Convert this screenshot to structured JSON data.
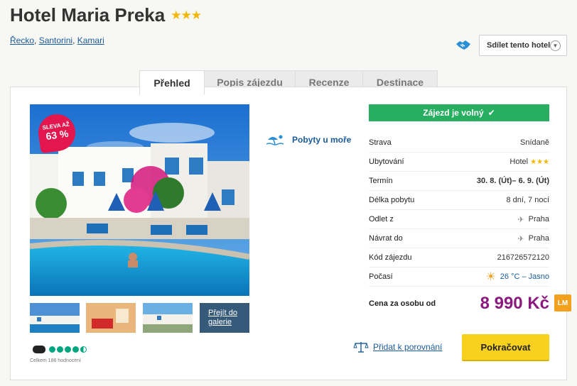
{
  "hotel": {
    "name": "Hotel Maria Preka",
    "stars": "★★★"
  },
  "breadcrumb": [
    "Řecko",
    "Santorini",
    "Kamari"
  ],
  "share": {
    "label": "Sdílet tento hotel"
  },
  "tabs": [
    "Přehled",
    "Popis zájezdu",
    "Recenze",
    "Destinace"
  ],
  "badge": {
    "line1": "SLEVA AŽ",
    "line2": "63 %"
  },
  "gallery": {
    "label": "Přejít do galerie"
  },
  "tripadvisor": {
    "rating": 4.5,
    "count_text": "Celkem 186 hodnocení"
  },
  "category": {
    "label": "Pobyty u moře"
  },
  "availability": {
    "label": "Zájezd je volný",
    "icon": "check-icon"
  },
  "details": [
    {
      "key": "Strava",
      "value": "Snídaně"
    },
    {
      "key": "Ubytování",
      "value": "Hotel",
      "stars": "★★★"
    },
    {
      "key": "Termín",
      "value": "30. 8. (Út)– 6. 9. (Út)"
    },
    {
      "key": "Délka pobytu",
      "value": "8 dní, 7 nocí"
    },
    {
      "key": "Odlet z",
      "value": "Praha",
      "icon": "plane-icon"
    },
    {
      "key": "Návrat do",
      "value": "Praha",
      "icon": "plane-icon"
    },
    {
      "key": "Kód zájezdu",
      "value": "216726572120"
    },
    {
      "key": "Počasí",
      "value": "26 °C – Jasno",
      "icon": "sun-icon"
    }
  ],
  "price": {
    "label": "Cena za osobu od",
    "value": "8 990 Kč",
    "badge": "LM"
  },
  "compare": {
    "label": "Přidat k porovnání"
  },
  "cta": {
    "label": "Pokračovat"
  },
  "colors": {
    "accent": "#8b1a7e",
    "green": "#27ae60",
    "cta": "#f7d11e",
    "link": "#1a5a99"
  }
}
